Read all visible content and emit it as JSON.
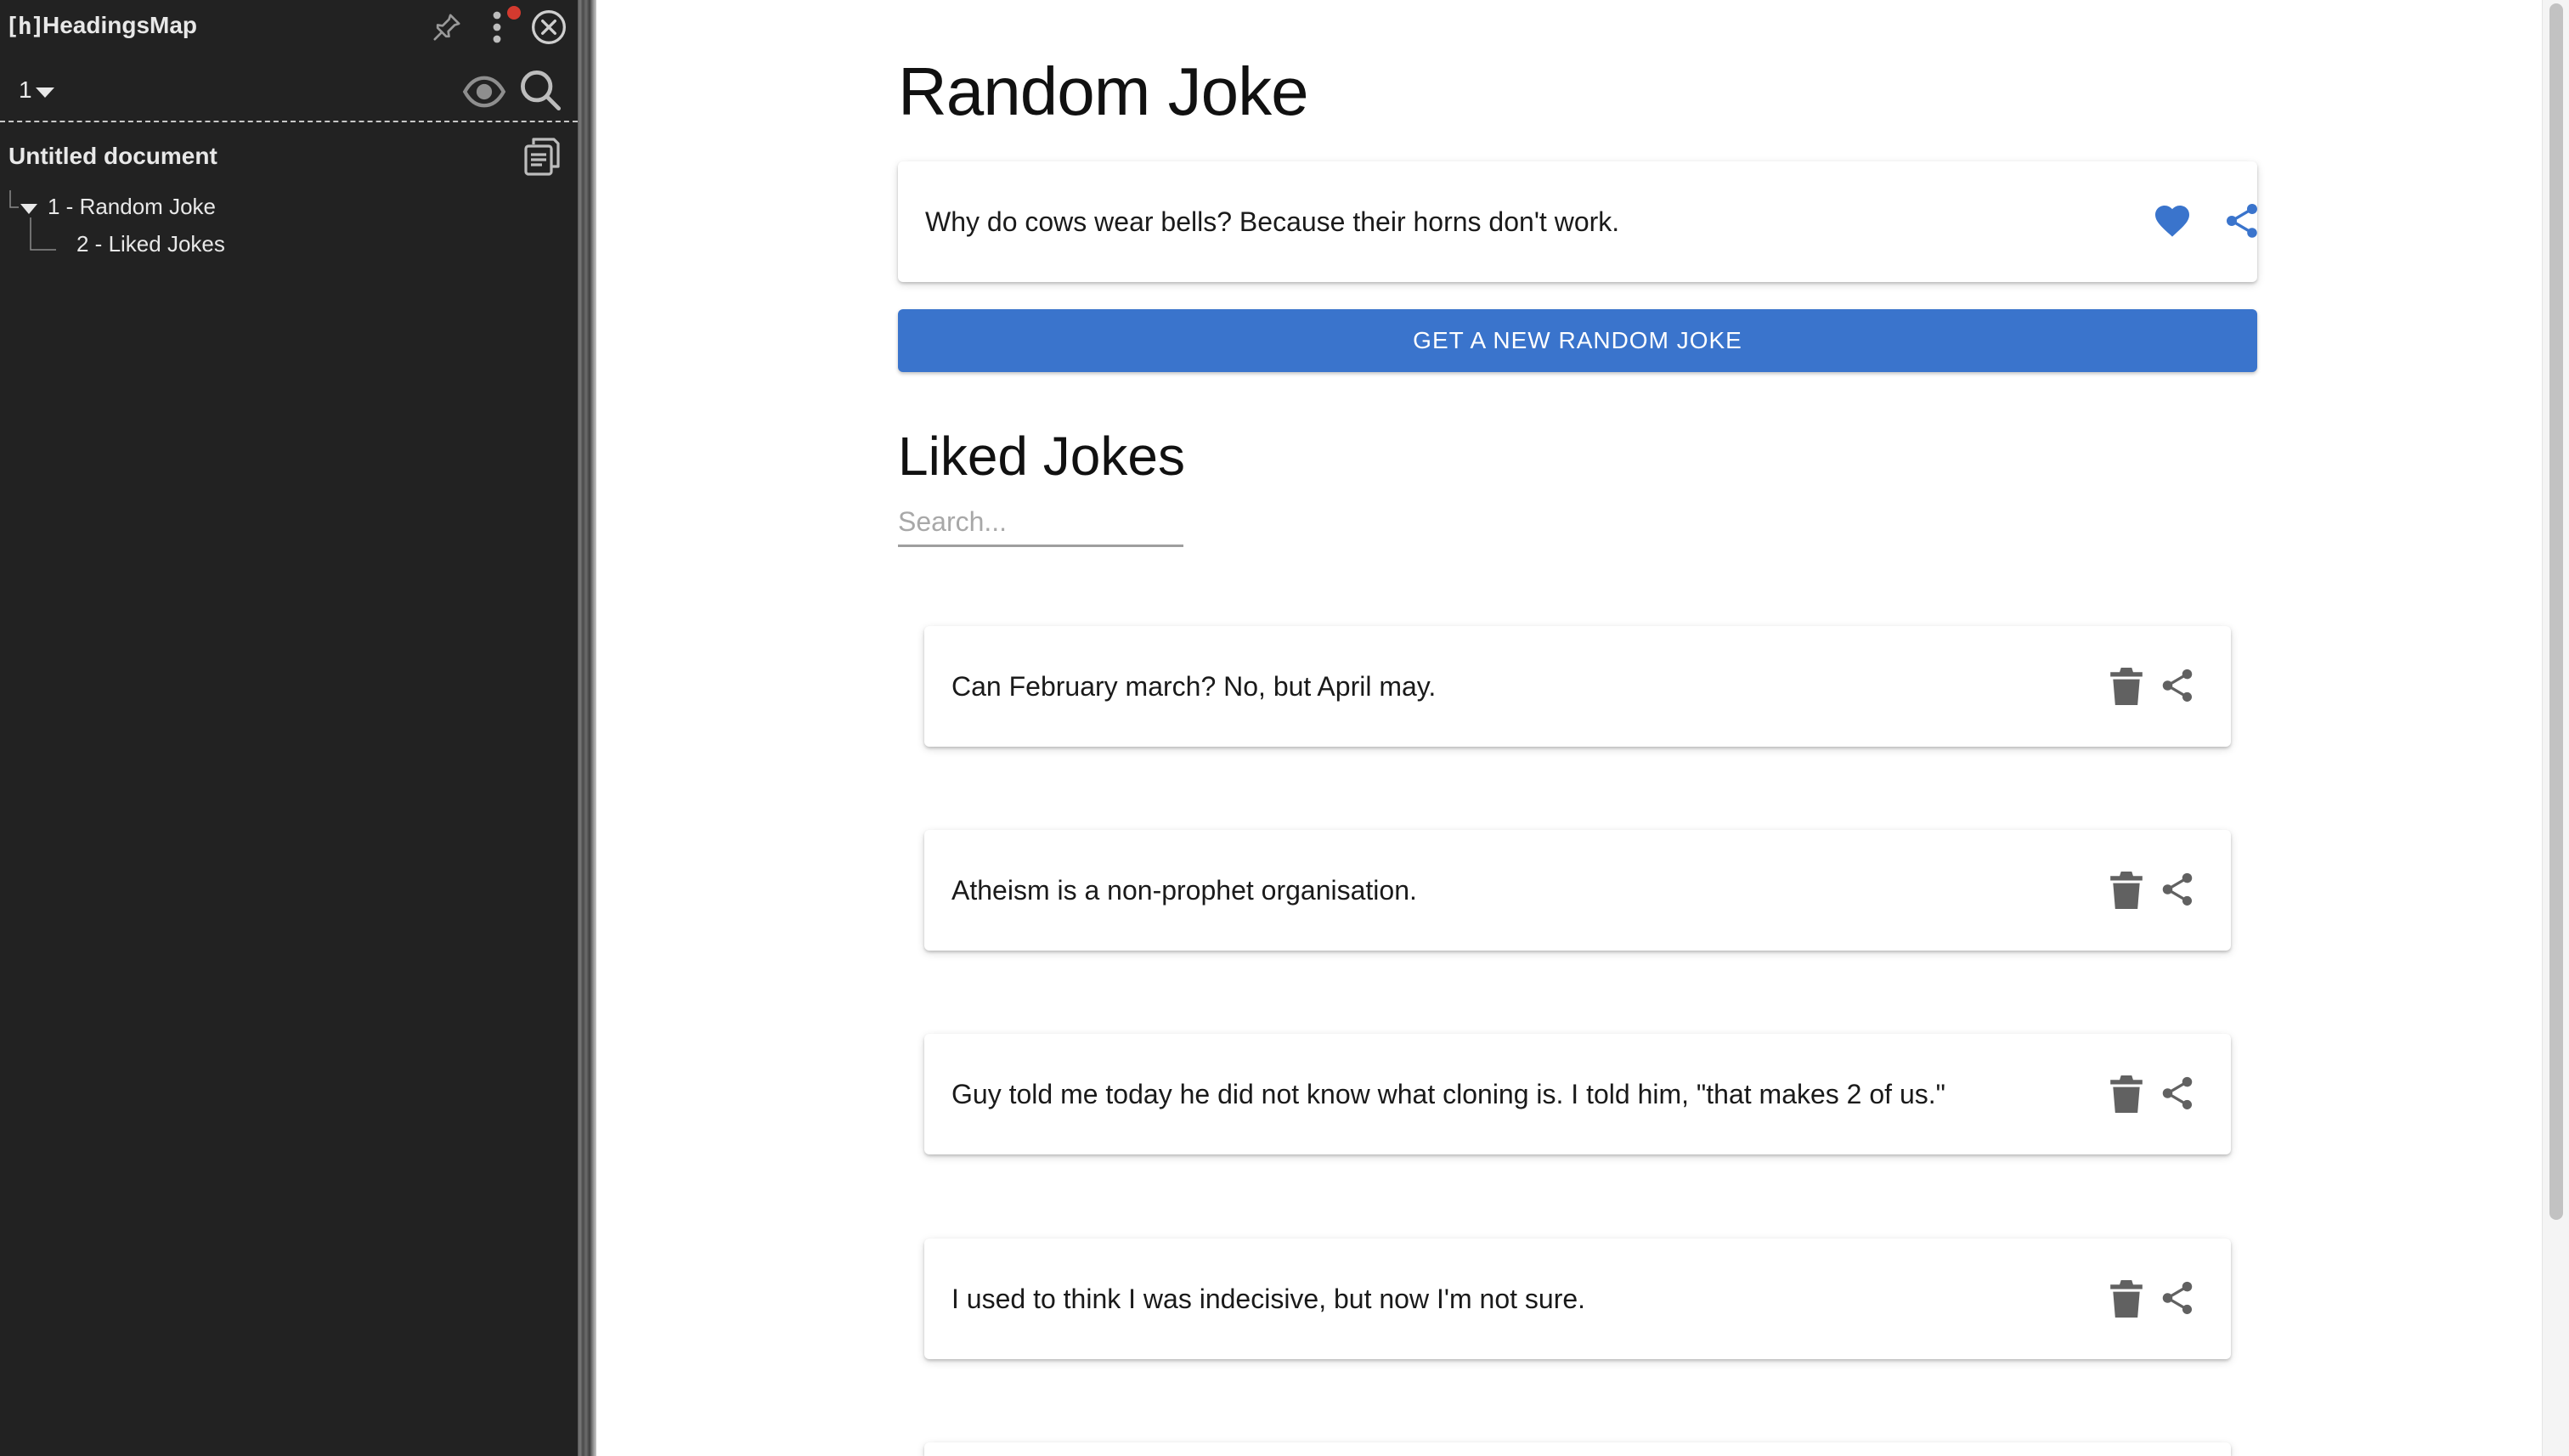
{
  "headingsmap": {
    "logo": "[h]",
    "title": "HeadingsMap",
    "level": "1",
    "document_title": "Untitled document",
    "tree": [
      {
        "label": "1 - Random Joke"
      },
      {
        "label": "2 - Liked Jokes"
      }
    ]
  },
  "page": {
    "title": "Random Joke",
    "current_joke": "Why do cows wear bells? Because their horns don't work.",
    "new_joke_button": "GET A NEW RANDOM JOKE",
    "liked_title": "Liked Jokes",
    "search_placeholder": "Search...",
    "search_value": "",
    "liked_jokes": [
      "Can February march? No, but April may.",
      "Atheism is a non-prophet organisation.",
      "Guy told me today he did not know what cloning is. I told him, \"that makes 2 of us.\"",
      "I used to think I was indecisive, but now I'm not sure."
    ]
  },
  "colors": {
    "panel_bg": "#222222",
    "accent": "#3a74cc",
    "icon_gray": "#616161",
    "notification": "#d43a2f"
  },
  "icons": {
    "like": "heart-icon",
    "share": "share-icon",
    "delete": "trash-icon",
    "pin": "pin-icon",
    "more": "more-vertical-icon",
    "close": "close-icon",
    "eye": "eye-icon",
    "search": "search-icon",
    "copy": "copy-icon"
  }
}
